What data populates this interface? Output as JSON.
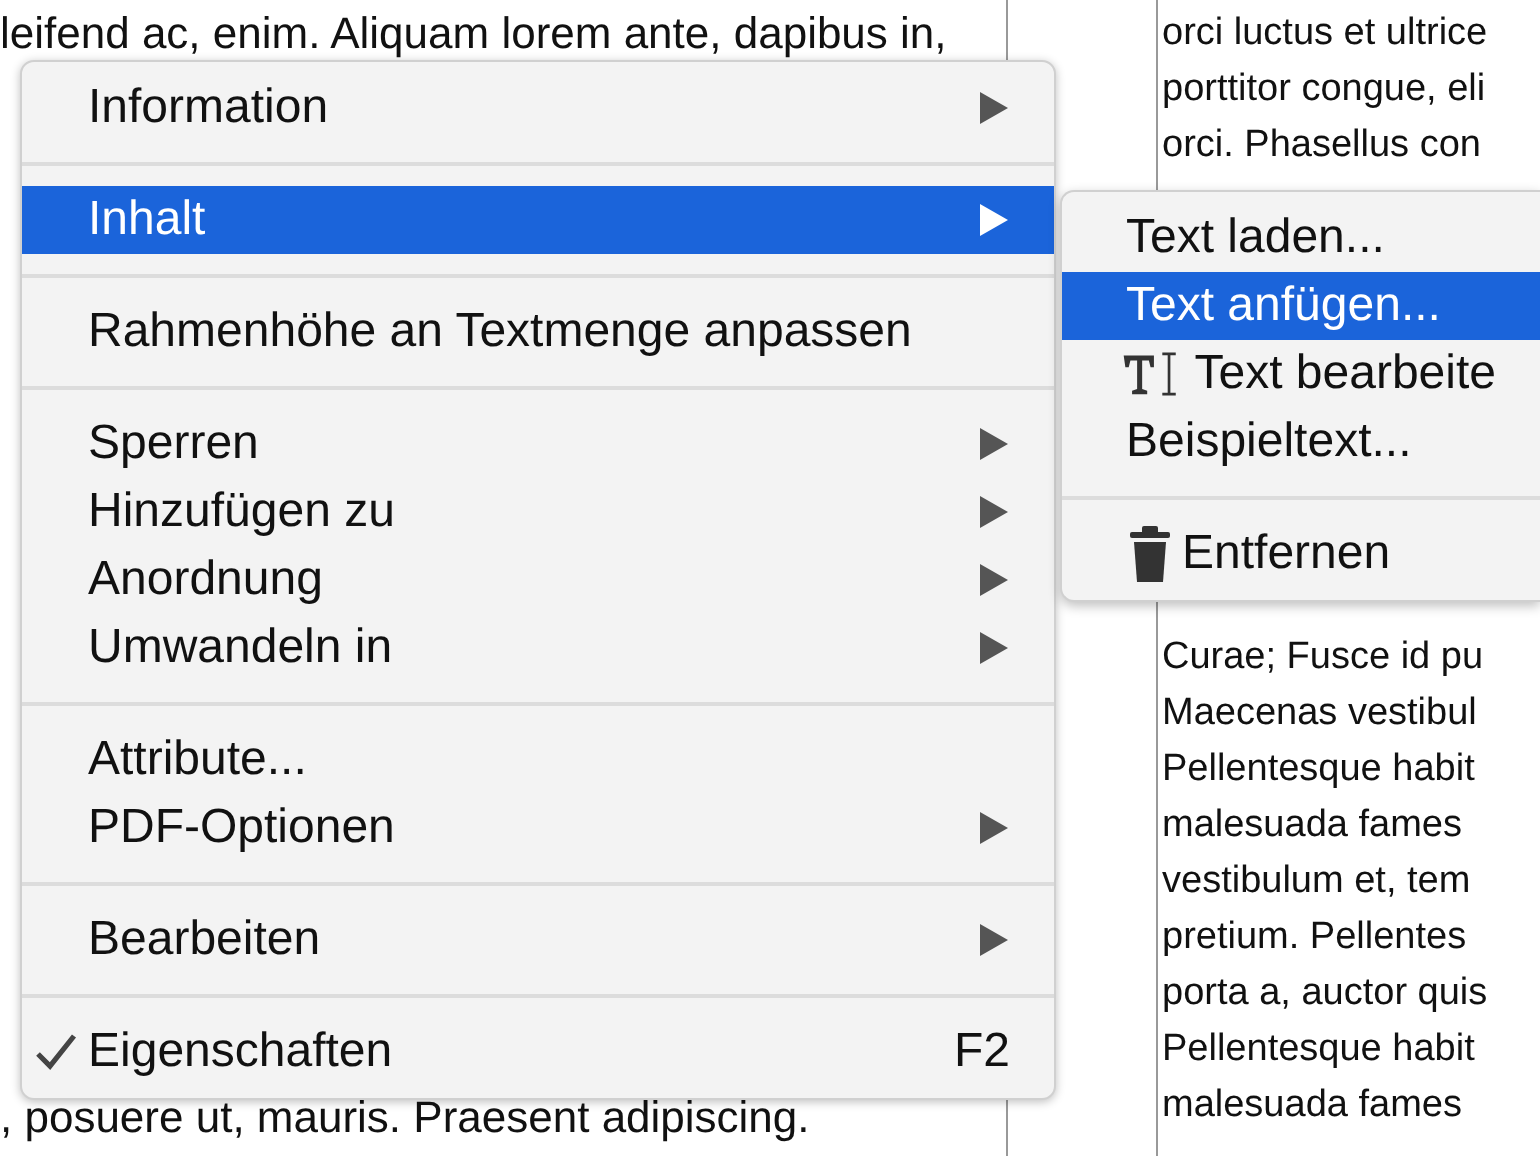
{
  "document": {
    "left_column_top": [
      "leifend ac, enim. Aliquam lorem ante, dapibus in,"
    ],
    "left_column_bottom": [
      ", posuere ut, mauris. Praesent adipiscing."
    ],
    "right_column_top": [
      "orci luctus et ultrice",
      "porttitor congue, eli",
      "orci. Phasellus con"
    ],
    "right_column_bottom": [
      "Curae; Fusce id pu",
      "Maecenas vestibul",
      "Pellentesque habit",
      "malesuada fames",
      "vestibulum et, tem",
      "pretium. Pellentes",
      "porta a, auctor quis",
      "Pellentesque habit",
      "malesuada fames"
    ]
  },
  "context_menu": {
    "items": [
      {
        "kind": "item",
        "label": "Information",
        "has_submenu": true,
        "selected": false,
        "checked": false
      },
      {
        "kind": "separator"
      },
      {
        "kind": "item",
        "label": "Inhalt",
        "has_submenu": true,
        "selected": true,
        "checked": false
      },
      {
        "kind": "separator"
      },
      {
        "kind": "item",
        "label": "Rahmenhöhe an Textmenge anpassen",
        "has_submenu": false,
        "selected": false,
        "checked": false
      },
      {
        "kind": "separator"
      },
      {
        "kind": "item",
        "label": "Sperren",
        "has_submenu": true,
        "selected": false,
        "checked": false
      },
      {
        "kind": "item",
        "label": "Hinzufügen zu",
        "has_submenu": true,
        "selected": false,
        "checked": false
      },
      {
        "kind": "item",
        "label": "Anordnung",
        "has_submenu": true,
        "selected": false,
        "checked": false
      },
      {
        "kind": "item",
        "label": "Umwandeln in",
        "has_submenu": true,
        "selected": false,
        "checked": false
      },
      {
        "kind": "separator"
      },
      {
        "kind": "item",
        "label": "Attribute...",
        "has_submenu": false,
        "selected": false,
        "checked": false
      },
      {
        "kind": "item",
        "label": "PDF-Optionen",
        "has_submenu": true,
        "selected": false,
        "checked": false
      },
      {
        "kind": "separator"
      },
      {
        "kind": "item",
        "label": "Bearbeiten",
        "has_submenu": true,
        "selected": false,
        "checked": false
      },
      {
        "kind": "separator"
      },
      {
        "kind": "item",
        "label": "Eigenschaften",
        "has_submenu": false,
        "selected": false,
        "checked": true,
        "shortcut": "F2"
      }
    ]
  },
  "submenu": {
    "items": [
      {
        "kind": "item",
        "label": "Text laden...",
        "selected": false
      },
      {
        "kind": "item",
        "label": "Text anfügen...",
        "selected": true
      },
      {
        "kind": "edit-item",
        "label": "Text bearbeite",
        "selected": false
      },
      {
        "kind": "item",
        "label": "Beispieltext...",
        "selected": false
      },
      {
        "kind": "separator"
      },
      {
        "kind": "delete-item",
        "label": "Entfernen",
        "selected": false
      }
    ]
  }
}
